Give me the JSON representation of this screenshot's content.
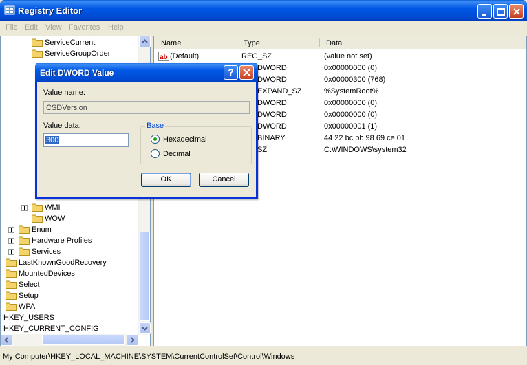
{
  "window": {
    "title": "Registry Editor",
    "menu": [
      "File",
      "Edit",
      "View",
      "Favorites",
      "Help"
    ]
  },
  "tree": {
    "items": [
      {
        "label": "ServiceCurrent",
        "indent": 3,
        "expandable": false
      },
      {
        "label": "ServiceGroupOrder",
        "indent": 3,
        "expandable": false
      },
      {
        "label": "WMI",
        "indent": 3,
        "expandable": true
      },
      {
        "label": "WOW",
        "indent": 3,
        "expandable": false
      },
      {
        "label": "Enum",
        "indent": 2,
        "expandable": true
      },
      {
        "label": "Hardware Profiles",
        "indent": 2,
        "expandable": true
      },
      {
        "label": "Services",
        "indent": 2,
        "expandable": true
      },
      {
        "label": "LastKnownGoodRecovery",
        "indent": 1,
        "expandable": false
      },
      {
        "label": "MountedDevices",
        "indent": 1,
        "expandable": false
      },
      {
        "label": "Select",
        "indent": 1,
        "expandable": false
      },
      {
        "label": "Setup",
        "indent": 1,
        "expandable": true
      },
      {
        "label": "WPA",
        "indent": 1,
        "expandable": true
      },
      {
        "label": "HKEY_USERS",
        "indent": 0,
        "expandable": false
      },
      {
        "label": "HKEY_CURRENT_CONFIG",
        "indent": 0,
        "expandable": false
      }
    ]
  },
  "list": {
    "columns": [
      "Name",
      "Type",
      "Data"
    ],
    "rows": [
      {
        "name": "(Default)",
        "type": "REG_SZ",
        "data": "(value not set)"
      },
      {
        "name": "",
        "type": "DWORD",
        "data": "0x00000000 (0)"
      },
      {
        "name": "",
        "type": "DWORD",
        "data": "0x00000300 (768)"
      },
      {
        "name": "",
        "type": "EXPAND_SZ",
        "data": "%SystemRoot%"
      },
      {
        "name": "",
        "type": "DWORD",
        "data": "0x00000000 (0)"
      },
      {
        "name": "",
        "type": "DWORD",
        "data": "0x00000000 (0)"
      },
      {
        "name": "",
        "type": "DWORD",
        "data": "0x00000001 (1)"
      },
      {
        "name": "",
        "type": "BINARY",
        "data": "44 22 bc bb 98 69 ce 01"
      },
      {
        "name": "",
        "type": "SZ",
        "data": "C:\\WINDOWS\\system32"
      }
    ]
  },
  "status": "My Computer\\HKEY_LOCAL_MACHINE\\SYSTEM\\CurrentControlSet\\Control\\Windows",
  "dialog": {
    "title": "Edit DWORD Value",
    "help_glyph": "?",
    "value_name_label": "Value name:",
    "value_name": "CSDVersion",
    "value_data_label": "Value data:",
    "value_data": "300",
    "base_label": "Base",
    "options": [
      {
        "label": "Hexadecimal",
        "checked": true
      },
      {
        "label": "Decimal",
        "checked": false
      }
    ],
    "ok_label": "OK",
    "cancel_label": "Cancel"
  },
  "colors": {
    "titlebar": "#0058e6",
    "selection": "#316ac5",
    "folder": "#f5d36b"
  }
}
